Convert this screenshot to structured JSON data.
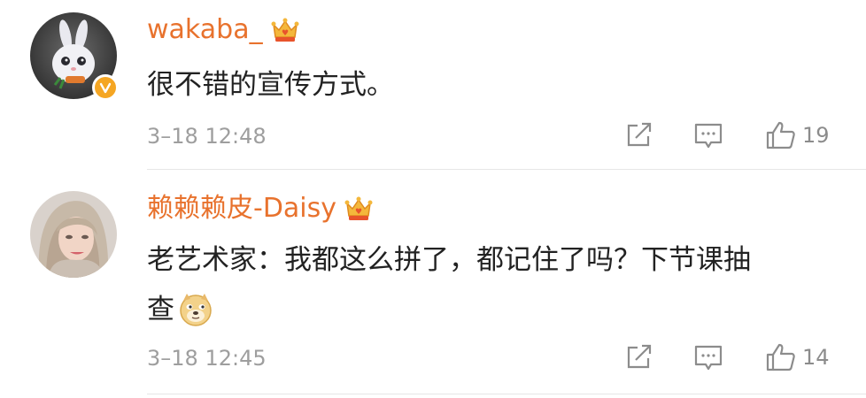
{
  "comments": [
    {
      "username": "wakaba_",
      "text": "很不错的宣传方式。",
      "time": "3–18 12:48",
      "likes": "19",
      "verified": true,
      "avatar_icon": "bunny-avatar",
      "badge_icon": "crown-vip-icon"
    },
    {
      "username": "赖赖赖皮-Daisy",
      "text_line1": "老艺术家：我都这么拼了，都记住了吗？下节课抽",
      "text_line2": "查",
      "emoji_icon": "doge-emoji-icon",
      "time": "3–18 12:45",
      "likes": "14",
      "verified": false,
      "avatar_icon": "woman-photo-avatar",
      "badge_icon": "crown-vip-icon"
    }
  ],
  "colors": {
    "username": "#e8722d",
    "text": "#222222",
    "meta": "#9e9e9e",
    "verified_badge": "#f5a623"
  }
}
